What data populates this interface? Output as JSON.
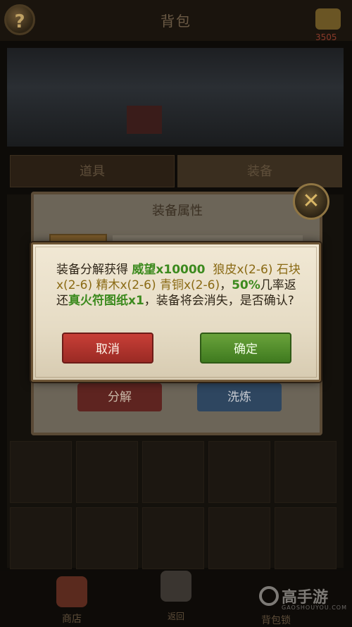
{
  "header": {
    "title": "背包",
    "gold": "3505"
  },
  "tabs": [
    {
      "label": "道具"
    },
    {
      "label": "装备"
    }
  ],
  "attr_panel": {
    "title": "装备属性",
    "decompose_label": "分解",
    "refine_label": "洗炼"
  },
  "dialog": {
    "seg1": "装备分解获得 ",
    "reward1": "威望x10000",
    "reward2": "狼皮x(2-6) 石块x(2-6) 精木x(2-6) 青铜x(2-6)",
    "sep": "，",
    "percent": "50%",
    "seg2": "几率返还",
    "reward3": "真火符图纸x1",
    "seg3": "，装备将会消失，是否确认?",
    "cancel_label": "取消",
    "ok_label": "确定"
  },
  "bottom_nav": [
    {
      "label": "商店"
    },
    {
      "label": "返回"
    },
    {
      "label": "背包锁"
    }
  ],
  "watermark": {
    "text": "高手游",
    "sub": "GAOSHOUYOU.COM"
  },
  "colors": {
    "reward_green": "#3c8a1e",
    "reward_olive": "#8a6a14",
    "cancel_red": "#b8352e",
    "ok_green": "#559034"
  }
}
